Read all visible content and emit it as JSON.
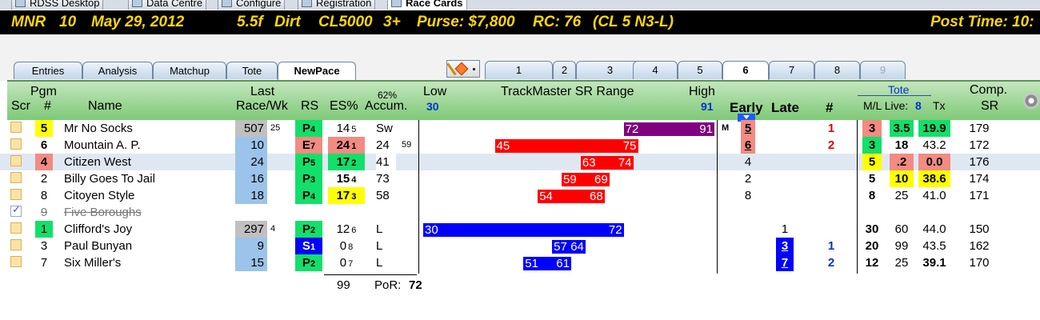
{
  "app_tabs": [
    {
      "label": "RDSS Desktop",
      "active": false
    },
    {
      "label": "Data Centre",
      "active": false
    },
    {
      "label": "Configure",
      "active": false
    },
    {
      "label": "Registration",
      "active": false
    },
    {
      "label": "Race Cards",
      "active": true
    }
  ],
  "race": {
    "track": "MNR",
    "race_no": "10",
    "date": "May 29, 2012",
    "distance": "5.5f",
    "surface": "Dirt",
    "class": "CL5000",
    "age": "3+",
    "purse": "Purse: $7,800",
    "rc": "RC: 76",
    "cond": "(CL 5 N3-L)",
    "post_time": "Post Time: 10:"
  },
  "view_tabs": [
    {
      "label": "Entries",
      "active": false
    },
    {
      "label": "Analysis",
      "active": false
    },
    {
      "label": "Matchup",
      "active": false
    },
    {
      "label": "Tote",
      "active": false
    },
    {
      "label": "NewPace",
      "active": true
    }
  ],
  "race_tabs": [
    {
      "label": "1",
      "state": "normal"
    },
    {
      "label": "2",
      "state": "normal"
    },
    {
      "label": "3",
      "state": "normal"
    },
    {
      "label": "4",
      "state": "normal"
    },
    {
      "label": "5",
      "state": "normal"
    },
    {
      "label": "6",
      "state": "active"
    },
    {
      "label": "7",
      "state": "normal"
    },
    {
      "label": "8",
      "state": "normal"
    },
    {
      "label": "9",
      "state": "disabled"
    }
  ],
  "icons": {
    "pace_button": "pace-chart-icon",
    "settings": "gear-icon",
    "early_marker": "triangle-down-icon"
  },
  "header": {
    "pgm": "Pgm",
    "scr": "Scr",
    "pgm_num": "#",
    "name": "Name",
    "last1": "Last",
    "last2": "Race/Wk",
    "rs": "RS",
    "es": "ES%",
    "accum_pct": "62%",
    "accum": "Accum.",
    "low": "Low",
    "low_val": "30",
    "range_title": "TrackMaster SR Range",
    "high": "High",
    "high_val": "91",
    "early": "Early",
    "late": "Late",
    "num": "#",
    "tote": "Tote",
    "ml_live": "M/L Live:",
    "live_count": "8",
    "tx": "Tx",
    "comp": "Comp.",
    "sr": "SR"
  },
  "colors": {
    "green_header": "#7ec977",
    "yellow": "#ffff00",
    "green": "#11e06a",
    "salmon": "#f28b82",
    "gray": "#c0c0c0",
    "light_blue": "#9cc3ea",
    "red_bar": "#ff0000",
    "purple_bar": "#800080",
    "blue_bar": "#0000ff",
    "light_yellow": "#ffffd0"
  },
  "sr_scale": {
    "low": 30,
    "high": 91
  },
  "entries": [
    {
      "checked": false,
      "pgm": "5",
      "pgm_bg": "#ffff00",
      "pgm_bold": true,
      "name": "Mr No Socks",
      "scratched": false,
      "last": "507",
      "last_bg": "#c0c0c0",
      "last_n": "25",
      "rs_letter": "P",
      "rs_n": "4",
      "rs_bg": "#11e06a",
      "rs_fg": "#000",
      "es": "14",
      "es_n": "5",
      "es_bg": "",
      "es_bold": false,
      "accum": "Sw",
      "accum_bg": "#ffffff",
      "accum_n": "",
      "sr_low": 72,
      "sr_high": 91,
      "bar_color": "#800080",
      "mark": "M",
      "early": "5",
      "early_bg": "#f28b82",
      "early_ul": true,
      "late": "",
      "late_bg": "",
      "num": "1",
      "num_color": "red",
      "ml": "3",
      "ml_bg": "#f28b82",
      "live": "3.5",
      "live_bg": "#11e06a",
      "live_bold": true,
      "tx": "19.9",
      "tx_bg": "#11e06a",
      "tx_bold": true,
      "sr": "179",
      "highlight": false
    },
    {
      "checked": false,
      "pgm": "6",
      "pgm_bg": "",
      "pgm_bold": true,
      "name": "Mountain A. P.",
      "scratched": false,
      "last": "10",
      "last_bg": "#9cc3ea",
      "last_n": "",
      "rs_letter": "E",
      "rs_n": "7",
      "rs_bg": "#f28b82",
      "rs_fg": "#000",
      "es": "24",
      "es_n": "1",
      "es_bg": "#f28b82",
      "es_bold": true,
      "accum": "24",
      "accum_bg": "#ffffff",
      "accum_n": "59",
      "sr_low": 45,
      "sr_high": 75,
      "bar_color": "#ff0000",
      "mark": "",
      "early": "6",
      "early_bg": "#f28b82",
      "early_ul": true,
      "late": "",
      "late_bg": "",
      "num": "2",
      "num_color": "red",
      "ml": "3",
      "ml_bg": "#11e06a",
      "live": "18",
      "live_bg": "",
      "live_bold": true,
      "tx": "43.2",
      "tx_bg": "",
      "tx_bold": false,
      "sr": "172",
      "highlight": false
    },
    {
      "checked": false,
      "pgm": "4",
      "pgm_bg": "#f28b82",
      "pgm_bold": true,
      "name": "Citizen West",
      "scratched": false,
      "last": "24",
      "last_bg": "#9cc3ea",
      "last_n": "",
      "rs_letter": "P",
      "rs_n": "5",
      "rs_bg": "#11e06a",
      "rs_fg": "#000",
      "es": "17",
      "es_n": "2",
      "es_bg": "#11e06a",
      "es_bold": true,
      "accum": "41",
      "accum_bg": "#ffffff",
      "accum_n": "",
      "sr_low": 63,
      "sr_high": 74,
      "bar_color": "#ff0000",
      "mark": "",
      "early": "4",
      "early_bg": "",
      "early_ul": false,
      "late": "",
      "late_bg": "",
      "num": "",
      "num_color": "",
      "ml": "5",
      "ml_bg": "#ffff00",
      "live": ".2",
      "live_bg": "#f28b82",
      "live_bold": true,
      "tx": "0.0",
      "tx_bg": "#f28b82",
      "tx_bold": true,
      "sr": "176",
      "highlight": true
    },
    {
      "checked": false,
      "pgm": "2",
      "pgm_bg": "",
      "pgm_bold": false,
      "name": "Billy Goes To Jail",
      "scratched": false,
      "last": "16",
      "last_bg": "#9cc3ea",
      "last_n": "",
      "rs_letter": "P",
      "rs_n": "3",
      "rs_bg": "#11e06a",
      "rs_fg": "#000",
      "es": "15",
      "es_n": "4",
      "es_bg": "",
      "es_bold": true,
      "accum": "73",
      "accum_bg": "#ffffff",
      "accum_n": "",
      "sr_low": 59,
      "sr_high": 69,
      "bar_color": "#ff0000",
      "mark": "",
      "early": "2",
      "early_bg": "",
      "early_ul": false,
      "late": "",
      "late_bg": "",
      "num": "",
      "num_color": "",
      "ml": "5",
      "ml_bg": "",
      "live": "10",
      "live_bg": "#ffff00",
      "live_bold": true,
      "tx": "38.6",
      "tx_bg": "#ffff00",
      "tx_bold": true,
      "sr": "174",
      "highlight": false
    },
    {
      "checked": false,
      "pgm": "8",
      "pgm_bg": "",
      "pgm_bold": false,
      "name": "Citoyen Style",
      "scratched": false,
      "last": "18",
      "last_bg": "#9cc3ea",
      "last_n": "",
      "rs_letter": "P",
      "rs_n": "4",
      "rs_bg": "#11e06a",
      "rs_fg": "#000",
      "es": "17",
      "es_n": "3",
      "es_bg": "#ffff00",
      "es_bold": true,
      "accum": "58",
      "accum_bg": "#ffffff",
      "accum_n": "",
      "sr_low": 54,
      "sr_high": 68,
      "bar_color": "#ff0000",
      "mark": "",
      "early": "8",
      "early_bg": "",
      "early_ul": false,
      "late": "",
      "late_bg": "",
      "num": "",
      "num_color": "",
      "ml": "8",
      "ml_bg": "",
      "live": "25",
      "live_bg": "",
      "live_bold": false,
      "tx": "41.0",
      "tx_bg": "",
      "tx_bold": false,
      "sr": "171",
      "highlight": false
    },
    {
      "checked": true,
      "pgm": "9",
      "pgm_bg": "",
      "pgm_bold": false,
      "name": "Five Boroughs",
      "scratched": true,
      "last": "",
      "last_bg": "",
      "last_n": "",
      "rs_letter": "",
      "rs_n": "",
      "rs_bg": "",
      "rs_fg": "#000",
      "es": "",
      "es_n": "",
      "es_bg": "",
      "es_bold": false,
      "accum": "",
      "accum_bg": "",
      "accum_n": "",
      "sr_low": null,
      "sr_high": null,
      "bar_color": "",
      "mark": "",
      "early": "",
      "early_bg": "",
      "early_ul": false,
      "late": "",
      "late_bg": "",
      "num": "",
      "num_color": "",
      "ml": "",
      "ml_bg": "",
      "live": "",
      "live_bg": "",
      "live_bold": false,
      "tx": "",
      "tx_bg": "",
      "tx_bold": false,
      "sr": "",
      "highlight": false
    },
    {
      "checked": false,
      "pgm": "1",
      "pgm_bg": "#11e06a",
      "pgm_bold": false,
      "name": "Clifford's Joy",
      "scratched": false,
      "last": "297",
      "last_bg": "#c0c0c0",
      "last_n": "4",
      "rs_letter": "P",
      "rs_n": "2",
      "rs_bg": "#11e06a",
      "rs_fg": "#000",
      "es": "12",
      "es_n": "6",
      "es_bg": "",
      "es_bold": false,
      "accum": "L",
      "accum_bg": "",
      "accum_n": "",
      "sr_low": 30,
      "sr_high": 72,
      "bar_color": "#0000ff",
      "mark": "",
      "early": "",
      "early_bg": "",
      "early_ul": false,
      "late": "1",
      "late_bg": "",
      "num": "",
      "num_color": "",
      "ml": "30",
      "ml_bg": "",
      "live": "60",
      "live_bg": "",
      "live_bold": false,
      "tx": "44.0",
      "tx_bg": "",
      "tx_bold": false,
      "sr": "150",
      "highlight": false
    },
    {
      "checked": false,
      "pgm": "3",
      "pgm_bg": "",
      "pgm_bold": false,
      "name": "Paul Bunyan",
      "scratched": false,
      "last": "9",
      "last_bg": "#9cc3ea",
      "last_n": "",
      "rs_letter": "S",
      "rs_n": "1",
      "rs_bg": "#0000ff",
      "rs_fg": "#ffffff",
      "es": "0",
      "es_n": "8",
      "es_bg": "",
      "es_bold": false,
      "accum": "L",
      "accum_bg": "",
      "accum_n": "",
      "sr_low": 57,
      "sr_high": 64,
      "bar_color": "#0000ff",
      "mark": "",
      "early": "",
      "early_bg": "",
      "early_ul": false,
      "late": "3",
      "late_bg": "#0000ff",
      "num": "1",
      "num_color": "blue",
      "ml": "20",
      "ml_bg": "",
      "live": "99",
      "live_bg": "",
      "live_bold": false,
      "tx": "43.5",
      "tx_bg": "",
      "tx_bold": false,
      "sr": "162",
      "highlight": false
    },
    {
      "checked": false,
      "pgm": "7",
      "pgm_bg": "",
      "pgm_bold": false,
      "name": "Six Miller's",
      "scratched": false,
      "last": "15",
      "last_bg": "#9cc3ea",
      "last_n": "",
      "rs_letter": "P",
      "rs_n": "2",
      "rs_bg": "#11e06a",
      "rs_fg": "#000",
      "es": "0",
      "es_n": "7",
      "es_bg": "",
      "es_bold": false,
      "accum": "L",
      "accum_bg": "",
      "accum_n": "",
      "sr_low": 51,
      "sr_high": 61,
      "bar_color": "#0000ff",
      "mark": "",
      "early": "",
      "early_bg": "",
      "early_ul": false,
      "late": "7",
      "late_bg": "#0000ff",
      "num": "2",
      "num_color": "blue",
      "ml": "12",
      "ml_bg": "",
      "live": "25",
      "live_bg": "",
      "live_bold": false,
      "tx": "39.1",
      "tx_bg": "",
      "tx_bold": true,
      "sr": "170",
      "highlight": false
    }
  ],
  "footer": {
    "es_total": "99",
    "por_label": "PoR:",
    "por_value": "72"
  }
}
